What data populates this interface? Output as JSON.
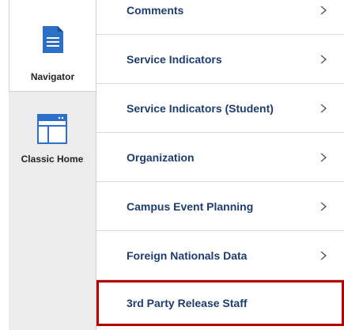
{
  "rail": {
    "items": [
      {
        "label": "Navigator",
        "icon": "document-icon"
      },
      {
        "label": "Classic Home",
        "icon": "window-icon"
      }
    ]
  },
  "menu": {
    "items": [
      {
        "label": "Comments",
        "chevron": true
      },
      {
        "label": "Service Indicators",
        "chevron": true
      },
      {
        "label": "Service Indicators (Student)",
        "chevron": true
      },
      {
        "label": "Organization",
        "chevron": true
      },
      {
        "label": "Campus Event Planning",
        "chevron": true
      },
      {
        "label": "Foreign Nationals Data",
        "chevron": true
      },
      {
        "label": "3rd Party Release Staff",
        "chevron": false,
        "highlighted": true
      }
    ]
  },
  "colors": {
    "accent": "#2b6fc9",
    "item_text": "#1d3d6e",
    "highlight_border": "#b30000",
    "rail_bg": "#ececec"
  }
}
